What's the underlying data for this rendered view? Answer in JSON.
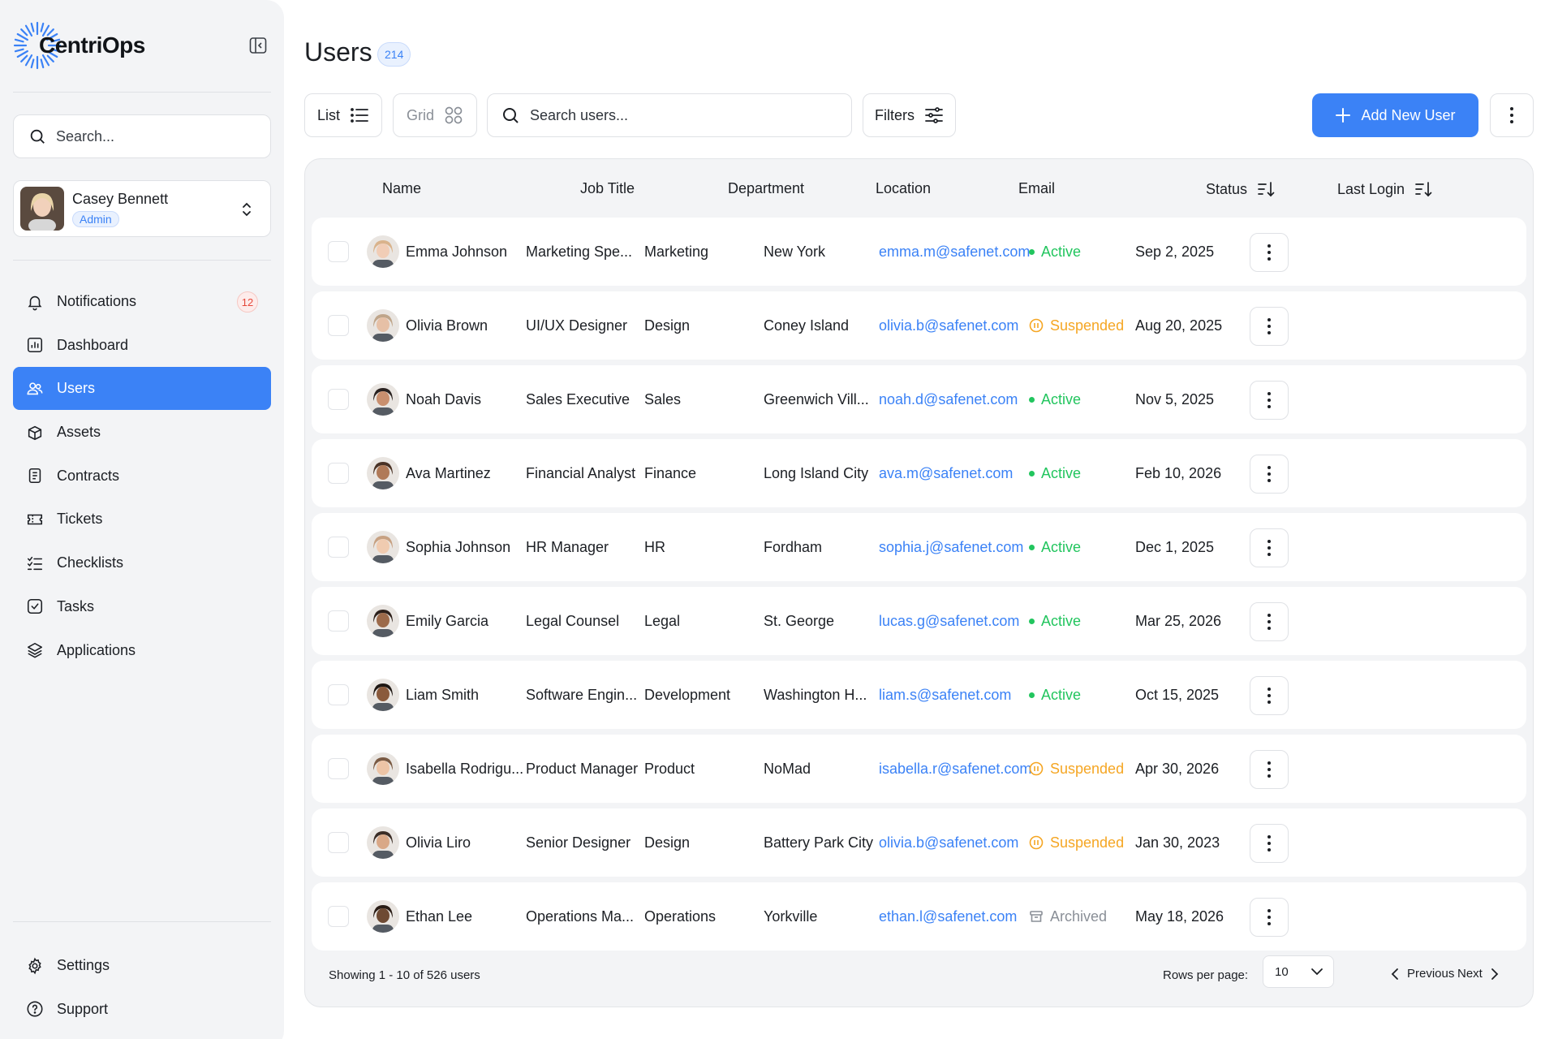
{
  "brand": {
    "name": "CentriOps"
  },
  "sidebar": {
    "search_placeholder": "Search...",
    "profile": {
      "name": "Casey Bennett",
      "role": "Admin"
    },
    "items": [
      {
        "label": "Notifications",
        "icon": "bell-icon",
        "badge": "12"
      },
      {
        "label": "Dashboard",
        "icon": "dashboard-icon"
      },
      {
        "label": "Users",
        "icon": "users-icon",
        "active": true
      },
      {
        "label": "Assets",
        "icon": "box-icon"
      },
      {
        "label": "Contracts",
        "icon": "document-icon"
      },
      {
        "label": "Tickets",
        "icon": "ticket-icon"
      },
      {
        "label": "Checklists",
        "icon": "checklist-icon"
      },
      {
        "label": "Tasks",
        "icon": "task-check-icon"
      },
      {
        "label": "Applications",
        "icon": "layers-icon"
      }
    ],
    "bottom_items": [
      {
        "label": "Settings",
        "icon": "gear-icon"
      },
      {
        "label": "Support",
        "icon": "help-icon"
      }
    ]
  },
  "header": {
    "title": "Users",
    "count": "214"
  },
  "toolbar": {
    "list_label": "List",
    "grid_label": "Grid",
    "search_placeholder": "Search users...",
    "filters_label": "Filters",
    "add_label": "Add New User"
  },
  "table": {
    "columns": [
      "Name",
      "Job Title",
      "Department",
      "Location",
      "Email",
      "Status",
      "Last Login"
    ],
    "rows": [
      {
        "name": "Emma Johnson",
        "job": "Marketing Spe...",
        "dept": "Marketing",
        "location": "New York",
        "email": "emma.m@safenet.com",
        "status": "Active",
        "last_login": "Sep 2, 2025"
      },
      {
        "name": "Olivia Brown",
        "job": "UI/UX Designer",
        "dept": "Design",
        "location": "Coney Island",
        "email": "olivia.b@safenet.com",
        "status": "Suspended",
        "last_login": "Aug 20, 2025"
      },
      {
        "name": "Noah Davis",
        "job": "Sales Executive",
        "dept": "Sales",
        "location": "Greenwich Vill...",
        "email": "noah.d@safenet.com",
        "status": "Active",
        "last_login": "Nov 5, 2025"
      },
      {
        "name": "Ava Martinez",
        "job": "Financial Analyst",
        "dept": "Finance",
        "location": "Long Island City",
        "email": "ava.m@safenet.com",
        "status": "Active",
        "last_login": "Feb 10, 2026"
      },
      {
        "name": "Sophia Johnson",
        "job": "HR Manager",
        "dept": "HR",
        "location": "Fordham",
        "email": "sophia.j@safenet.com",
        "status": "Active",
        "last_login": "Dec 1, 2025"
      },
      {
        "name": "Emily Garcia",
        "job": "Legal Counsel",
        "dept": "Legal",
        "location": "St. George",
        "email": "lucas.g@safenet.com",
        "status": "Active",
        "last_login": "Mar 25, 2026"
      },
      {
        "name": "Liam Smith",
        "job": "Software Engin...",
        "dept": "Development",
        "location": "Washington H...",
        "email": "liam.s@safenet.com",
        "status": "Active",
        "last_login": "Oct 15, 2025"
      },
      {
        "name": "Isabella Rodrigu...",
        "job": "Product Manager",
        "dept": "Product",
        "location": "NoMad",
        "email": "isabella.r@safenet.com",
        "status": "Suspended",
        "last_login": "Apr 30, 2026"
      },
      {
        "name": "Olivia Liro",
        "job": "Senior Designer",
        "dept": "Design",
        "location": "Battery Park City",
        "email": "olivia.b@safenet.com",
        "status": "Suspended",
        "last_login": "Jan 30, 2023"
      },
      {
        "name": "Ethan Lee",
        "job": "Operations Ma...",
        "dept": "Operations",
        "location": "Yorkville",
        "email": "ethan.l@safenet.com",
        "status": "Archived",
        "last_login": "May 18, 2026"
      }
    ]
  },
  "footer": {
    "showing": "Showing 1 - 10 of 526 users",
    "rows_per_page_label": "Rows per page:",
    "rows_per_page_value": "10",
    "previous_label": "Previous",
    "next_label": "Next"
  },
  "colors": {
    "accent": "#3b82f6",
    "active": "#22c55e",
    "suspended": "#f5a623",
    "archived": "#8a8f97",
    "badge_red": "#e5483a"
  }
}
